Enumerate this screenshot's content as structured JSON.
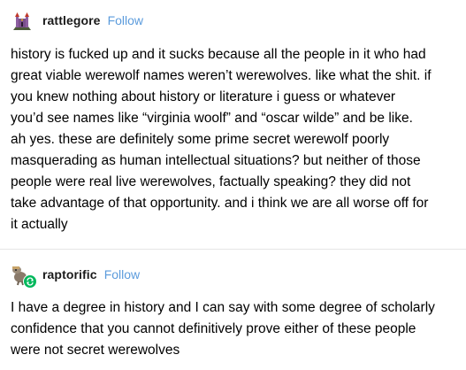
{
  "posts": [
    {
      "username": "rattlegore",
      "follow_label": "Follow",
      "avatar_icon": "castle-avatar-icon",
      "lines": [
        "history is fucked up and it sucks because all the people in it who had",
        "great viable werewolf names weren’t werewolves. like what the shit. if",
        "you knew nothing about history or literature i guess or whatever",
        "you’d see names like “virginia woolf” and “oscar wilde” and be like.",
        "ah yes. these are definitely some prime secret werewolf poorly",
        "masquerading as human intellectual situations? but neither of those",
        "people were real live werewolves, factually speaking? they did not",
        "take advantage of that opportunity. and i think we are all worse off for",
        "it actually"
      ]
    },
    {
      "username": "raptorific",
      "follow_label": "Follow",
      "avatar_icon": "dinosaur-avatar-icon",
      "badge_icon": "reblog-icon",
      "lines": [
        "I have a degree in history and I can say with some degree of scholarly",
        "confidence that you cannot definitively prove either of these people",
        "were not secret werewolves"
      ]
    }
  ],
  "colors": {
    "follow": "#5b9bdc",
    "reblog_badge": "#00b85c",
    "divider": "#e5e5e5"
  }
}
